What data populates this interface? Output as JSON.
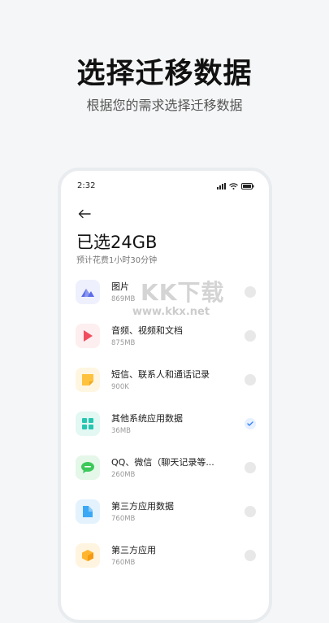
{
  "headline": "选择迁移数据",
  "subline": "根据您的需求选择迁移数据",
  "phone": {
    "status": {
      "time": "2:32"
    },
    "title": "已选24GB",
    "subtitle": "预计花费1小时30分钟",
    "items": [
      {
        "name": "图片",
        "size": "869MB",
        "icon": "picture-icon",
        "color": "#5b6de8",
        "checked": false
      },
      {
        "name": "音频、视频和文档",
        "size": "875MB",
        "icon": "media-play-icon",
        "color": "#f04e5e",
        "checked": false
      },
      {
        "name": "短信、联系人和通话记录",
        "size": "900K",
        "icon": "sms-contacts-icon",
        "color": "#ffc23c",
        "checked": false
      },
      {
        "name": "其他系统应用数据",
        "size": "36MB",
        "icon": "system-apps-icon",
        "color": "#26c6b0",
        "checked": true
      },
      {
        "name": "QQ、微信（聊天记录等...",
        "size": "260MB",
        "icon": "chat-icon",
        "color": "#3cc85a",
        "checked": false
      },
      {
        "name": "第三方应用数据",
        "size": "760MB",
        "icon": "app-data-icon",
        "color": "#3ba8f5",
        "checked": false
      },
      {
        "name": "第三方应用",
        "size": "760MB",
        "icon": "third-party-app-icon",
        "color": "#ffb52e",
        "checked": false
      }
    ]
  },
  "watermark": {
    "brand": "KK下载",
    "url": "www.kkx.net"
  }
}
